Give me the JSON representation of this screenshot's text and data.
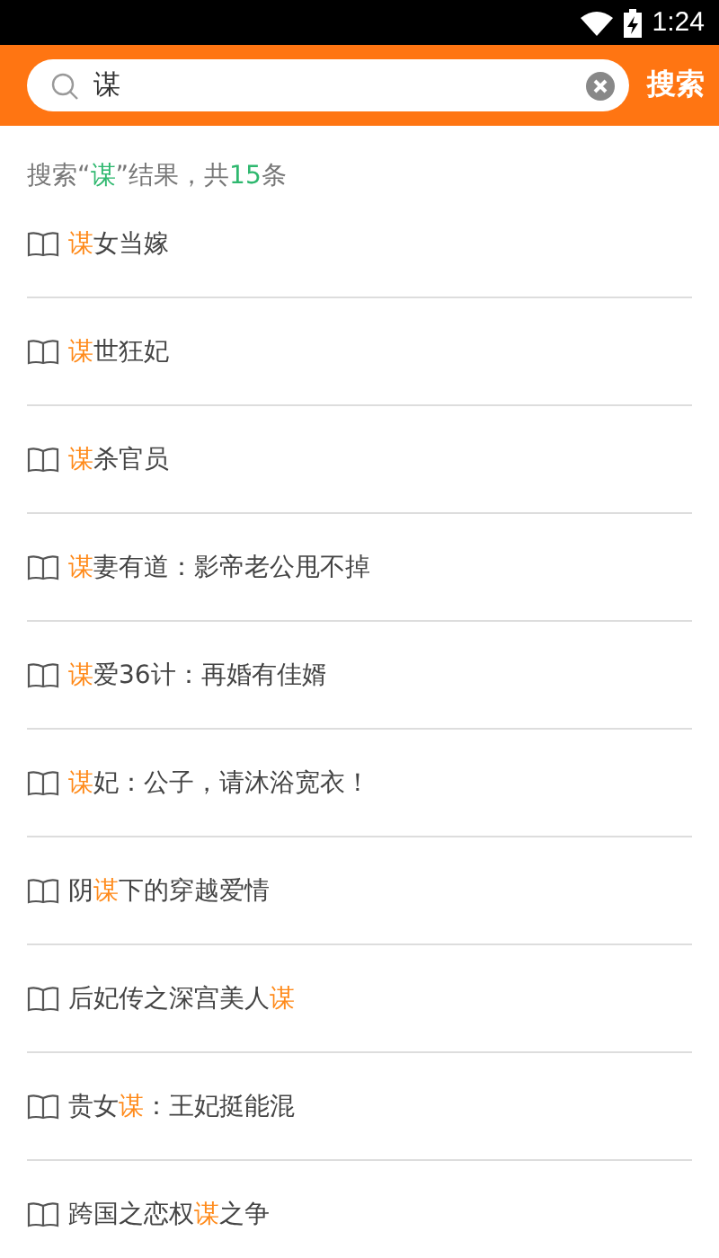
{
  "status_bar": {
    "time": "1:24"
  },
  "search": {
    "value": "谋",
    "button": "搜索"
  },
  "summary": [
    {
      "text": "搜索“",
      "highlight": false
    },
    {
      "text": "谋",
      "highlight": true
    },
    {
      "text": "”结果，共",
      "highlight": false
    },
    {
      "text": "15",
      "highlight": true
    },
    {
      "text": "条",
      "highlight": false
    }
  ],
  "results": [
    {
      "parts": [
        {
          "text": "谋",
          "highlight": true
        },
        {
          "text": "女当嫁",
          "highlight": false
        }
      ]
    },
    {
      "parts": [
        {
          "text": "谋",
          "highlight": true
        },
        {
          "text": "世狂妃",
          "highlight": false
        }
      ]
    },
    {
      "parts": [
        {
          "text": "谋",
          "highlight": true
        },
        {
          "text": "杀官员",
          "highlight": false
        }
      ]
    },
    {
      "parts": [
        {
          "text": "谋",
          "highlight": true
        },
        {
          "text": "妻有道：影帝老公甩不掉",
          "highlight": false
        }
      ]
    },
    {
      "parts": [
        {
          "text": "谋",
          "highlight": true
        },
        {
          "text": "爱36计：再婚有佳婿",
          "highlight": false
        }
      ]
    },
    {
      "parts": [
        {
          "text": "谋",
          "highlight": true
        },
        {
          "text": "妃：公子，请沐浴宽衣！",
          "highlight": false
        }
      ]
    },
    {
      "parts": [
        {
          "text": "阴",
          "highlight": false
        },
        {
          "text": "谋",
          "highlight": true
        },
        {
          "text": "下的穿越爱情",
          "highlight": false
        }
      ]
    },
    {
      "parts": [
        {
          "text": "后妃传之深宫美人",
          "highlight": false
        },
        {
          "text": "谋",
          "highlight": true
        }
      ]
    },
    {
      "parts": [
        {
          "text": "贵女",
          "highlight": false
        },
        {
          "text": "谋",
          "highlight": true
        },
        {
          "text": "：王妃挺能混",
          "highlight": false
        }
      ]
    },
    {
      "parts": [
        {
          "text": "跨国之恋权",
          "highlight": false
        },
        {
          "text": "谋",
          "highlight": true
        },
        {
          "text": "之争",
          "highlight": false
        }
      ]
    }
  ]
}
